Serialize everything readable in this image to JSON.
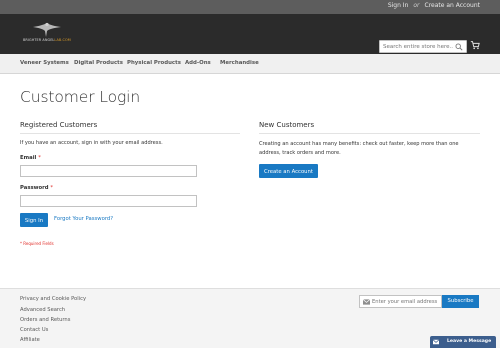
{
  "top_links": {
    "sign_in": "Sign In",
    "separator": "or",
    "create_account": "Create an Account"
  },
  "logo": {
    "text_main": "BRIGHTER ANGEL",
    "text_accent": "LAB.COM"
  },
  "search": {
    "placeholder": "Search entire store here..."
  },
  "nav": {
    "items": [
      "Veneer Systems",
      "Digital Products",
      "Physical Products",
      "Add-Ons",
      "Merchandise"
    ]
  },
  "page": {
    "title": "Customer Login"
  },
  "registered": {
    "title": "Registered Customers",
    "intro": "If you have an account, sign in with your email address.",
    "email_label": "Email",
    "password_label": "Password",
    "required_marker": "*",
    "sign_in_button": "Sign In",
    "forgot_link": "Forgot Your Password?",
    "required_note": "* Required Fields"
  },
  "new_customers": {
    "title": "New Customers",
    "description": "Creating an account has many benefits: check out faster, keep more than one address, track orders and more.",
    "create_button": "Create an Account"
  },
  "footer": {
    "links": [
      "Privacy and Cookie Policy",
      "Advanced Search",
      "Orders and Returns",
      "Contact Us",
      "Affiliate"
    ],
    "newsletter_placeholder": "Enter your email address",
    "subscribe_button": "Subscribe"
  },
  "chat": {
    "label": "Leave a Message"
  },
  "colors": {
    "topbar": "#5d5d5d",
    "header": "#2b2b2b",
    "accent_blue": "#1979c3",
    "required_red": "#e02b27",
    "logo_accent": "#d99c2b"
  }
}
